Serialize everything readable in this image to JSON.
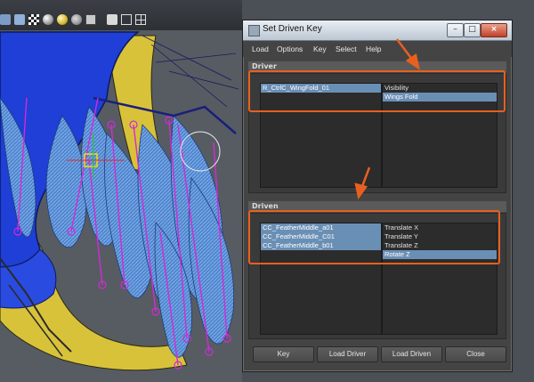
{
  "dialog": {
    "title": "Set Driven Key",
    "window_buttons": {
      "minimize": "–",
      "maximize": "□",
      "close": "×"
    },
    "menu": [
      "Load",
      "Options",
      "Key",
      "Select",
      "Help"
    ],
    "driver": {
      "header": "Driver",
      "objects": [
        {
          "label": "R_CtrlC_WingFold_01",
          "selected": true
        }
      ],
      "attributes": [
        {
          "label": "Visibility",
          "selected": false
        },
        {
          "label": "Wings Fold",
          "selected": true
        }
      ]
    },
    "driven": {
      "header": "Driven",
      "objects": [
        {
          "label": "CC_FeatherMiddle_a01",
          "selected": true
        },
        {
          "label": "CC_FeatherMiddle_C01",
          "selected": true
        },
        {
          "label": "CC_FeatherMiddle_b01",
          "selected": true
        }
      ],
      "attributes": [
        {
          "label": "Translate X",
          "selected": false
        },
        {
          "label": "Translate Y",
          "selected": false
        },
        {
          "label": "Translate Z",
          "selected": false
        },
        {
          "label": "Rotate Z",
          "selected": true
        }
      ]
    },
    "buttons": {
      "key": "Key",
      "load_driver": "Load Driver",
      "load_driven": "Load Driven",
      "close": "Close"
    }
  },
  "colors": {
    "highlight": "#6a8fb5",
    "callout": "#e8601f",
    "dialog_bg": "#444444"
  }
}
